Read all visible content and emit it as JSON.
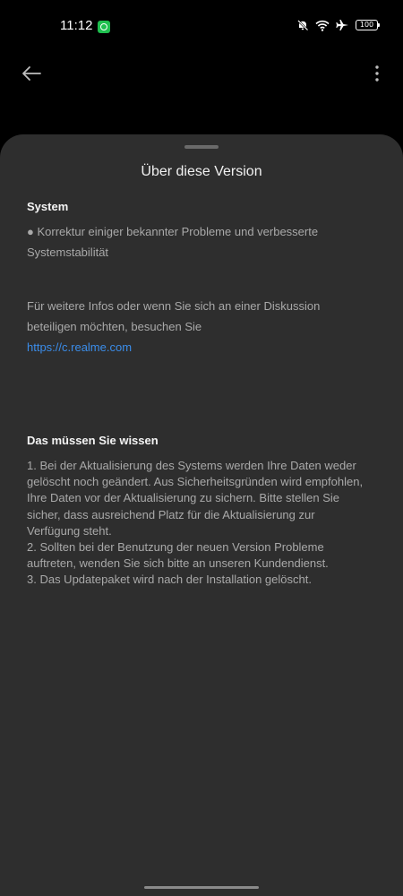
{
  "status_bar": {
    "time": "11:12",
    "battery": "100",
    "icons": [
      "app-notification-icon",
      "mute-bell-icon",
      "wifi-icon",
      "airplane-icon",
      "battery-icon"
    ]
  },
  "toolbar": {
    "back_icon": "arrow-left-icon",
    "more_icon": "more-vertical-icon"
  },
  "sheet": {
    "title": "Über diese Version",
    "system_heading": "System",
    "system_item_line1": "● Korrektur einiger bekannter Probleme und verbesserte",
    "system_item_line2": "Systemstabilität",
    "info_line1": "Für weitere Infos oder wenn Sie sich an einer Diskussion",
    "info_line2": "beteiligen möchten, besuchen Sie",
    "info_link": "https://c.realme.com",
    "notes_heading": "Das müssen Sie wissen",
    "notes": [
      "1. Bei der Aktualisierung des Systems werden Ihre Daten weder",
      "gelöscht noch geändert. Aus Sicherheitsgründen wird empfohlen,",
      "Ihre Daten vor der Aktualisierung zu sichern. Bitte stellen Sie",
      "sicher, dass ausreichend Platz für die Aktualisierung zur",
      "Verfügung steht.",
      "2. Sollten bei der Benutzung der neuen Version Probleme",
      "auftreten, wenden Sie sich bitte an unseren Kundendienst.",
      "3. Das Updatepaket wird nach der Installation gelöscht."
    ]
  },
  "colors": {
    "background": "#000000",
    "sheet": "#2e2e2e",
    "link": "#3b8dea",
    "body_text": "#a9a9a9",
    "app_icon": "#1fbf4f"
  }
}
